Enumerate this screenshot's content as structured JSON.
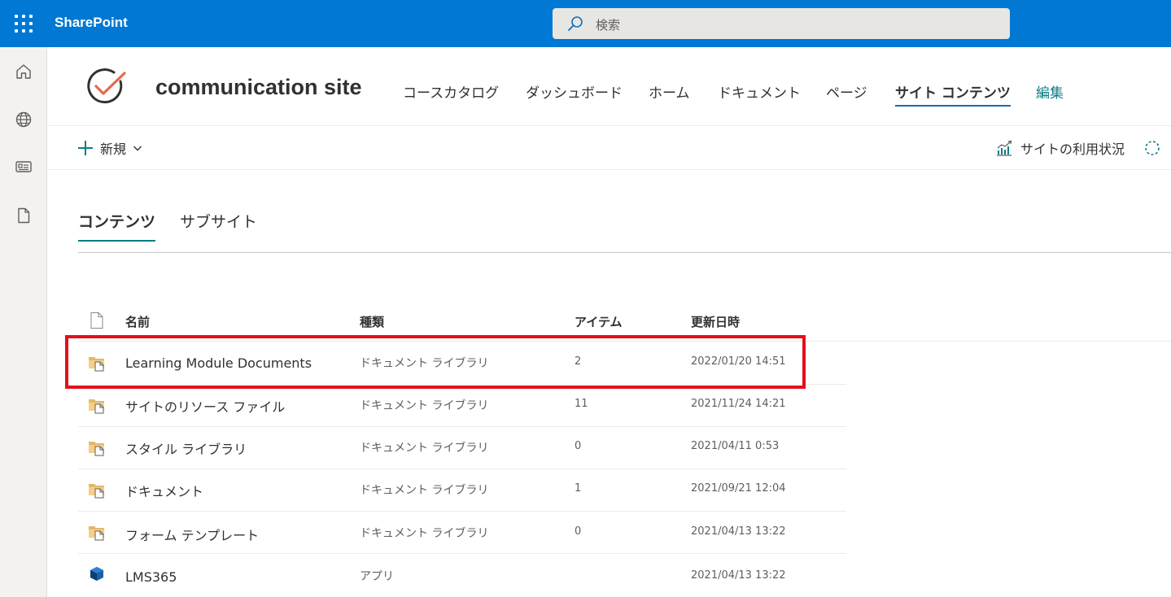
{
  "suitebar": {
    "app_name": "SharePoint",
    "search_placeholder": "検索"
  },
  "rail": {
    "items": [
      "home-icon",
      "globe-icon",
      "news-icon",
      "file-icon"
    ]
  },
  "site": {
    "title": "communication site",
    "nav": [
      {
        "label": "コースカタログ",
        "active": false
      },
      {
        "label": "ダッシュボード",
        "active": false
      },
      {
        "label": "ホーム",
        "active": false
      },
      {
        "label": "ドキュメント",
        "active": false
      },
      {
        "label": "ページ",
        "active": false
      },
      {
        "label": "サイト コンテンツ",
        "active": true
      },
      {
        "label": "編集",
        "active": false
      }
    ]
  },
  "commandbar": {
    "new_label": "新規",
    "usage_label": "サイトの利用状況"
  },
  "pivot": {
    "tabs": [
      {
        "label": "コンテンツ",
        "active": true
      },
      {
        "label": "サブサイト",
        "active": false
      }
    ]
  },
  "list": {
    "headers": {
      "name": "名前",
      "type": "種類",
      "items": "アイテム",
      "modified": "更新日時"
    },
    "rows": [
      {
        "icon": "library-icon",
        "name": "Learning Module Documents",
        "type": "ドキュメント ライブラリ",
        "items": "2",
        "modified": "2022/01/20 14:51"
      },
      {
        "icon": "library-icon",
        "name": "サイトのリソース ファイル",
        "type": "ドキュメント ライブラリ",
        "items": "11",
        "modified": "2021/11/24 14:21"
      },
      {
        "icon": "library-icon",
        "name": "スタイル ライブラリ",
        "type": "ドキュメント ライブラリ",
        "items": "0",
        "modified": "2021/04/11 0:53"
      },
      {
        "icon": "library-icon",
        "name": "ドキュメント",
        "type": "ドキュメント ライブラリ",
        "items": "1",
        "modified": "2021/09/21 12:04"
      },
      {
        "icon": "library-icon",
        "name": "フォーム テンプレート",
        "type": "ドキュメント ライブラリ",
        "items": "0",
        "modified": "2021/04/13 13:22"
      },
      {
        "icon": "app-icon",
        "name": "LMS365",
        "type": "アプリ",
        "items": "",
        "modified": "2021/04/13 13:22"
      }
    ]
  },
  "colors": {
    "suitebar": "#0078d4",
    "accent": "#0e7c86",
    "highlight": "#e3101b"
  }
}
